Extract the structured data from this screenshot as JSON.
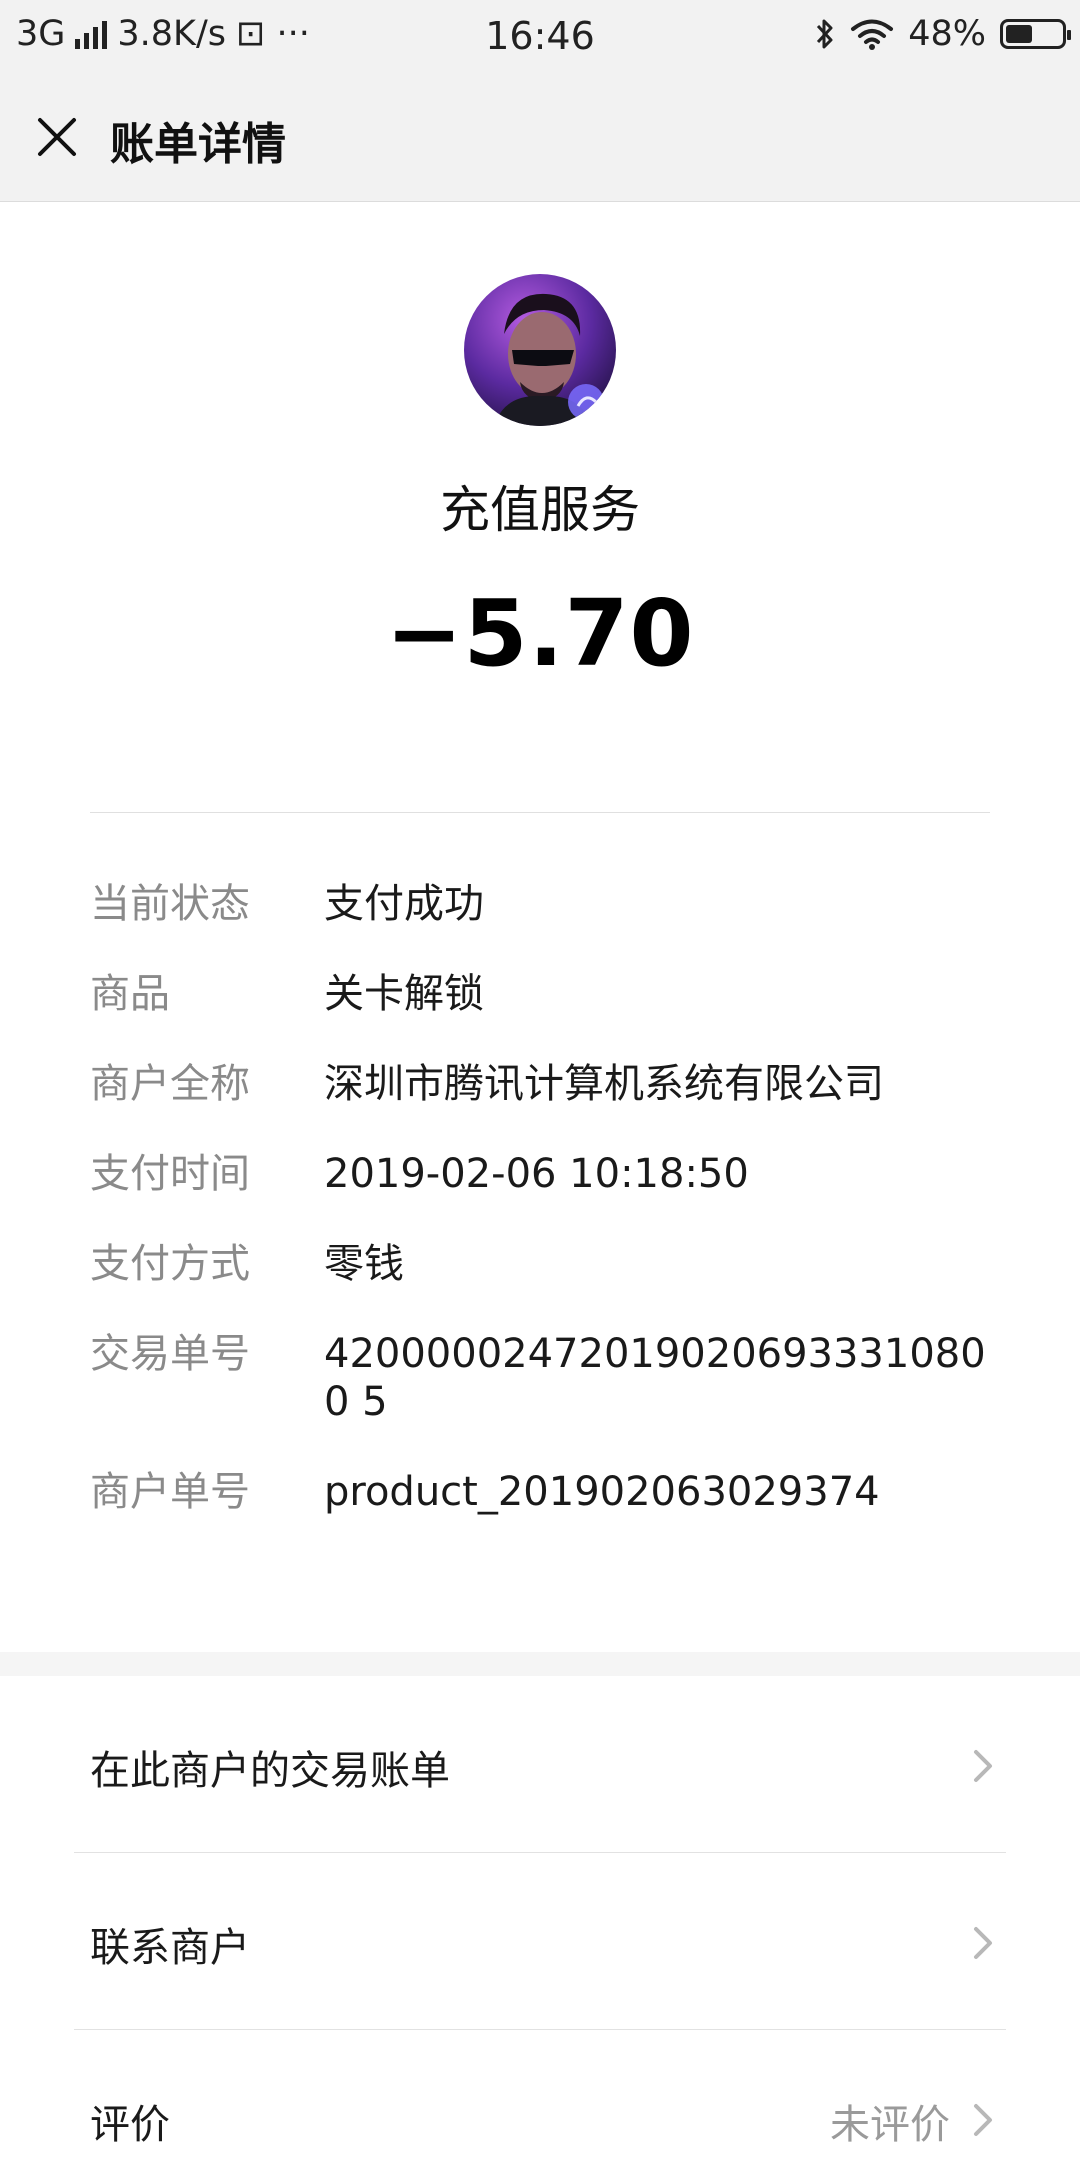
{
  "status_bar": {
    "network": "3G",
    "speed": "3.8K/s",
    "extra_icons": "⊡ ···",
    "time": "16:46",
    "battery_percent_text": "48%",
    "battery_level": 0.48
  },
  "header": {
    "title": "账单详情"
  },
  "merchant": {
    "name": "充值服务",
    "amount": "−5.70"
  },
  "details": [
    {
      "label": "当前状态",
      "value": "支付成功"
    },
    {
      "label": "商品",
      "value": "关卡解锁"
    },
    {
      "label": "商户全称",
      "value": "深圳市腾讯计算机系统有限公司"
    },
    {
      "label": "支付时间",
      "value": "2019-02-06 10:18:50"
    },
    {
      "label": "支付方式",
      "value": "零钱"
    },
    {
      "label": "交易单号",
      "value": "420000024720190206933310800 5"
    },
    {
      "label": "商户单号",
      "value": "product_201902063029374"
    }
  ],
  "actions": {
    "merchant_bills": "在此商户的交易账单",
    "contact_merchant": "联系商户",
    "rating_label": "评价",
    "rating_value": "未评价"
  }
}
